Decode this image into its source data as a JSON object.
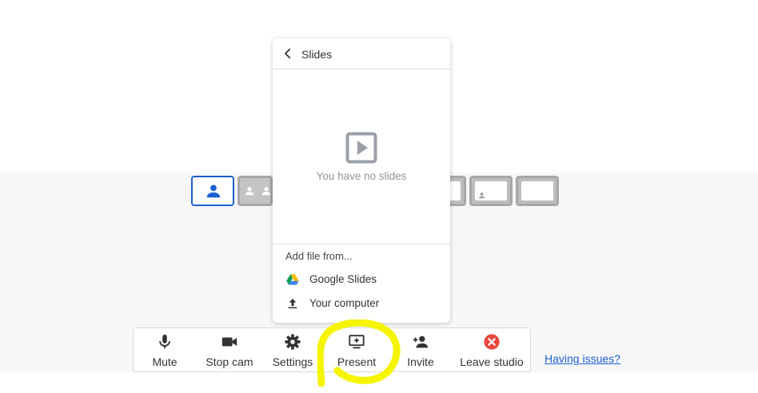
{
  "popup": {
    "title": "Slides",
    "empty_message": "You have no slides",
    "add_file_label": "Add file from...",
    "options": [
      {
        "label": "Google Slides",
        "icon": "google-drive-icon"
      },
      {
        "label": "Your computer",
        "icon": "upload-icon"
      }
    ]
  },
  "toolbar": {
    "buttons": [
      {
        "label": "Mute",
        "icon": "microphone-icon"
      },
      {
        "label": "Stop cam",
        "icon": "camera-icon"
      },
      {
        "label": "Settings",
        "icon": "gear-icon"
      },
      {
        "label": "Present",
        "icon": "present-screen-icon"
      },
      {
        "label": "Invite",
        "icon": "add-person-icon"
      },
      {
        "label": "Leave studio",
        "icon": "leave-x-icon"
      }
    ]
  },
  "issues_link": "Having issues?",
  "layouts": {
    "selected": 0
  },
  "colors": {
    "accent": "#1c5fd0",
    "leave_red": "#e8473b",
    "highlight_yellow": "#f5f500",
    "stage_bg": "#f7f7f9"
  }
}
